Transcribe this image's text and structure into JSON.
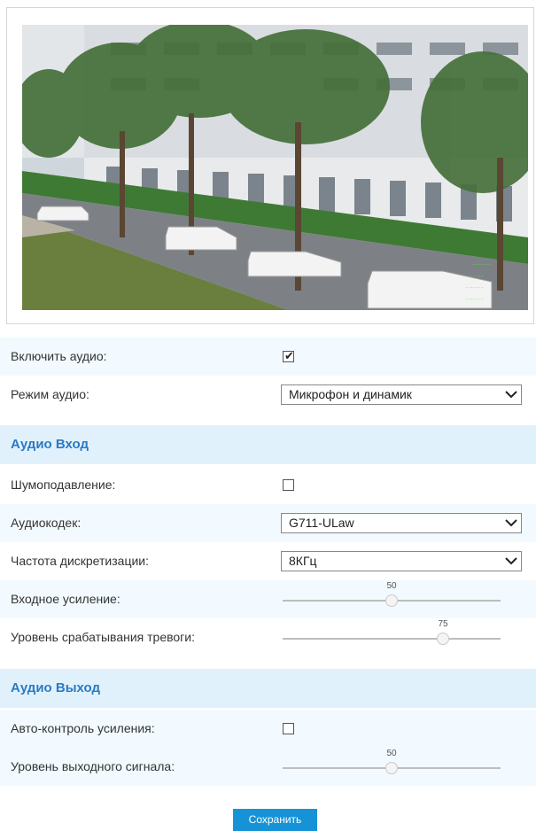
{
  "preview": {
    "image_description_icon": "camera-preview-icon"
  },
  "audio": {
    "enable_label": "Включить аудио:",
    "enable_checked": true,
    "mode_label": "Режим аудио:",
    "mode_value": "Микрофон и динамик"
  },
  "audio_in": {
    "title": "Аудио Вход",
    "noise_label": "Шумоподавление:",
    "noise_checked": false,
    "codec_label": "Аудиокодек:",
    "codec_value": "G711-ULaw",
    "rate_label": "Частота дискретизации:",
    "rate_value": "8КГц",
    "gain_label": "Входное усиление:",
    "gain_value": "50",
    "alarm_label": "Уровень срабатывания тревоги:",
    "alarm_value": "75"
  },
  "audio_out": {
    "title": "Аудио Выход",
    "agc_label": "Авто-контроль усиления:",
    "agc_checked": false,
    "level_label": "Уровень выходного сигнала:",
    "level_value": "50"
  },
  "actions": {
    "save_label": "Сохранить"
  },
  "colors": {
    "section_bg": "#e1f1fb",
    "row_shade": "#f2faff",
    "section_title": "#2a7ac4",
    "button": "#1693d6"
  }
}
